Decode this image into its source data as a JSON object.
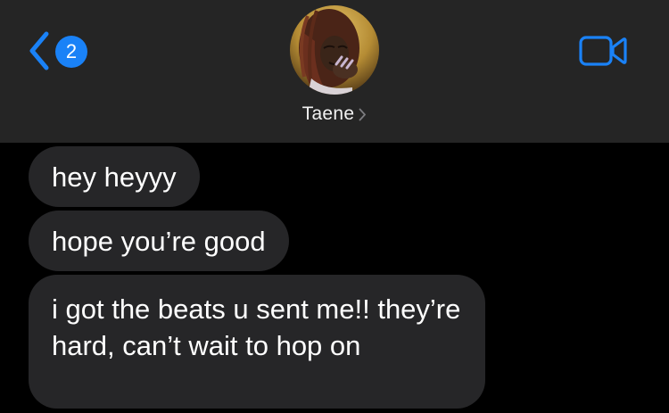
{
  "header": {
    "back_badge_count": "2",
    "contact_name": "Taene"
  },
  "messages": [
    {
      "text": "hey heyyy",
      "direction": "received"
    },
    {
      "text": "hope you’re good",
      "direction": "received"
    },
    {
      "text": "i got the beats u sent me!! they’re hard, can’t wait to hop on",
      "direction": "received"
    }
  ],
  "colors": {
    "accent": "#1a82f7",
    "header_bg": "#252525",
    "screen_bg": "#000000",
    "bubble_bg": "#262628",
    "text": "#ffffff"
  },
  "icons": {
    "back": "chevron-left-icon",
    "name_disclosure": "chevron-right-icon",
    "video": "video-camera-icon"
  }
}
